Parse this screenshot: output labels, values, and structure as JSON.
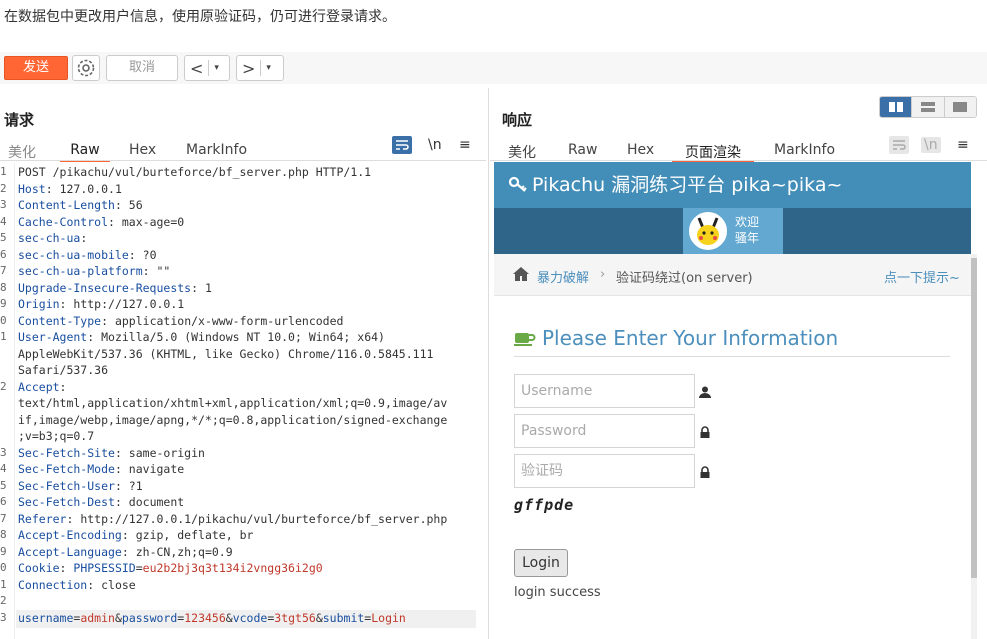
{
  "note": "在数据包中更改用户信息，使用原验证码，仍可进行登录请求。",
  "toolbar": {
    "send": "发送",
    "cancel": "取消",
    "back": "<",
    "forward": ">",
    "dropdown": "▾"
  },
  "request": {
    "title": "请求",
    "tabs": [
      "美化",
      "Raw",
      "Hex",
      "MarkInfo"
    ],
    "active_tab": "Raw",
    "newline_icon": "\\n",
    "menu_icon": "≡",
    "lines": [
      {
        "no": "1",
        "key": "",
        "sep": "",
        "val": "POST /pikachu/vul/burteforce/bf_server.php HTTP/1.1"
      },
      {
        "no": "2",
        "key": "Host",
        "sep": ": ",
        "val": "127.0.0.1"
      },
      {
        "no": "3",
        "key": "Content-Length",
        "sep": ": ",
        "val": "56"
      },
      {
        "no": "4",
        "key": "Cache-Control",
        "sep": ": ",
        "val": "max-age=0"
      },
      {
        "no": "5",
        "key": "sec-ch-ua",
        "sep": ":",
        "val": ""
      },
      {
        "no": "6",
        "key": "sec-ch-ua-mobile",
        "sep": ": ",
        "val": "?0"
      },
      {
        "no": "7",
        "key": "sec-ch-ua-platform",
        "sep": ": ",
        "val": "\"\""
      },
      {
        "no": "8",
        "key": "Upgrade-Insecure-Requests",
        "sep": ": ",
        "val": "1"
      },
      {
        "no": "9",
        "key": "Origin",
        "sep": ": ",
        "val": "http://127.0.0.1"
      },
      {
        "no": "0",
        "key": "Content-Type",
        "sep": ": ",
        "val": "application/x-www-form-urlencoded"
      },
      {
        "no": "1",
        "key": "User-Agent",
        "sep": ": ",
        "val": "Mozilla/5.0 (Windows NT 10.0; Win64; x64)"
      },
      {
        "no": "",
        "key": "",
        "sep": "",
        "val": "AppleWebKit/537.36 (KHTML, like Gecko) Chrome/116.0.5845.111"
      },
      {
        "no": "",
        "key": "",
        "sep": "",
        "val": "Safari/537.36"
      },
      {
        "no": "2",
        "key": "Accept",
        "sep": ":",
        "val": ""
      },
      {
        "no": "",
        "key": "",
        "sep": "",
        "val": "text/html,application/xhtml+xml,application/xml;q=0.9,image/av"
      },
      {
        "no": "",
        "key": "",
        "sep": "",
        "val": "if,image/webp,image/apng,*/*;q=0.8,application/signed-exchange"
      },
      {
        "no": "",
        "key": "",
        "sep": "",
        "val": ";v=b3;q=0.7"
      },
      {
        "no": "3",
        "key": "Sec-Fetch-Site",
        "sep": ": ",
        "val": "same-origin"
      },
      {
        "no": "4",
        "key": "Sec-Fetch-Mode",
        "sep": ": ",
        "val": "navigate"
      },
      {
        "no": "5",
        "key": "Sec-Fetch-User",
        "sep": ": ",
        "val": "?1"
      },
      {
        "no": "6",
        "key": "Sec-Fetch-Dest",
        "sep": ": ",
        "val": "document"
      },
      {
        "no": "7",
        "key": "Referer",
        "sep": ": ",
        "val": "http://127.0.0.1/pikachu/vul/burteforce/bf_server.php"
      },
      {
        "no": "8",
        "key": "Accept-Encoding",
        "sep": ": ",
        "val": "gzip, deflate, br"
      },
      {
        "no": "9",
        "key": "Accept-Language",
        "sep": ": ",
        "val": "zh-CN,zh;q=0.9"
      },
      {
        "no": "0",
        "key": "Cookie",
        "sep": ": ",
        "val": "",
        "cookie_name": "PHPSESSID",
        "cookie_value": "eu2b2bj3q3t134i2vngg36i2g0"
      },
      {
        "no": "1",
        "key": "Connection",
        "sep": ": ",
        "val": "close"
      },
      {
        "no": "2",
        "key": "",
        "sep": "",
        "val": ""
      },
      {
        "no": "3",
        "key": "",
        "sep": "",
        "val": "",
        "body": true
      }
    ],
    "body_params": [
      {
        "k": "username",
        "v": "admin"
      },
      {
        "k": "password",
        "v": "123456"
      },
      {
        "k": "vcode",
        "v": "3tgt56"
      },
      {
        "k": "submit",
        "v": "Login"
      }
    ]
  },
  "response": {
    "title": "响应",
    "tabs": [
      "美化",
      "Raw",
      "Hex",
      "页面渲染",
      "MarkInfo"
    ],
    "active_tab": "页面渲染",
    "newline_icon": "\\n",
    "menu_icon": "≡",
    "render": {
      "site_title": "Pikachu 漏洞练习平台 pika~pika~",
      "welcome_line1": "欢迎",
      "welcome_line2": "骚年",
      "breadcrumb_link": "暴力破解",
      "breadcrumb_sep": "›",
      "breadcrumb_current": "验证码绕过(on server)",
      "hint": "点一下提示~",
      "form_title": "Please Enter Your Information",
      "username_placeholder": "Username",
      "password_placeholder": "Password",
      "vcode_placeholder": "验证码",
      "captcha_text": "gffpde",
      "login_button": "Login",
      "login_message": "login success"
    }
  },
  "colors": {
    "accent": "#ff6633",
    "header_blue": "#438eb9",
    "link_blue": "#4c8fbd",
    "key_blue": "#1a4fa0",
    "value_red": "#c0392b"
  }
}
